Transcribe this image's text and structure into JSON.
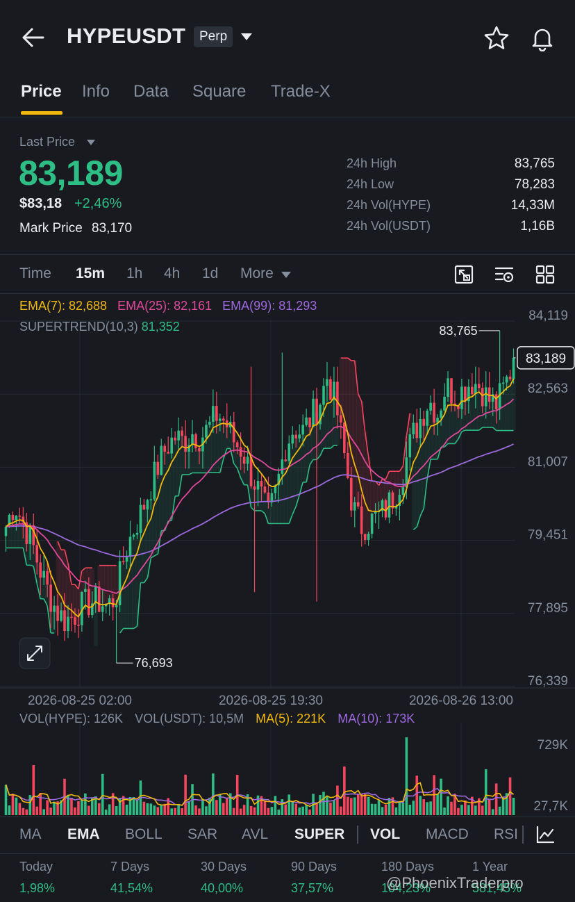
{
  "header": {
    "pair": "HYPEUSDT",
    "badge": "Perp"
  },
  "tabs": [
    {
      "label": "Price",
      "active": true
    },
    {
      "label": "Info"
    },
    {
      "label": "Data"
    },
    {
      "label": "Square"
    },
    {
      "label": "Trade-X"
    }
  ],
  "price": {
    "last_price_label": "Last Price",
    "last_price": "83,189",
    "usd_price": "$83,18",
    "change": "+2,46%",
    "mark_price_label": "Mark Price",
    "mark_price": "83,170"
  },
  "stats": [
    {
      "label": "24h High",
      "value": "83,765"
    },
    {
      "label": "24h Low",
      "value": "78,283"
    },
    {
      "label": "24h Vol(HYPE)",
      "value": "14,33M"
    },
    {
      "label": "24h Vol(USDT)",
      "value": "1,16B"
    }
  ],
  "intervals": {
    "time": "Time",
    "m15": "15m",
    "h1": "1h",
    "h4": "4h",
    "d1": "1d",
    "more": "More"
  },
  "legend": {
    "ema7": "EMA(7): 82,688",
    "ema25": "EMA(25): 82,161",
    "ema99": "EMA(99): 81,293",
    "supertrend_label": "SUPERTREND(10,3)",
    "supertrend_value": "81,352"
  },
  "volume_legend": {
    "vol_hype": "VOL(HYPE): 126K",
    "vol_usdt": "VOL(USDT): 10,5M",
    "ma5": "MA(5): 221K",
    "ma10": "MA(10): 173K"
  },
  "chart_data": {
    "type": "candlestick",
    "y_ticks": [
      "84,119",
      "82,563",
      "81,007",
      "79,451",
      "77,895",
      "76,339"
    ],
    "ylim": [
      76339,
      84119
    ],
    "x_ticks": [
      "2026-08-25 02:00",
      "2026-08-25 19:30",
      "2026-08-26 13:00"
    ],
    "current_price_label": "83,189",
    "current_price": 83189,
    "high_annotation": "83,765",
    "high_value": 83765,
    "low_annotation": "76,693",
    "low_value": 76693,
    "close_path": [
      79600,
      80100,
      79700,
      79300,
      78700,
      78200,
      77800,
      77600,
      77700,
      77900,
      78000,
      78000,
      77900,
      78100,
      79000,
      79500,
      79900,
      80400,
      80900,
      81300,
      81500,
      81400,
      81600,
      81500,
      81700,
      82000,
      81800,
      81400,
      81200,
      80700,
      80300,
      79800,
      80400,
      81300,
      81700,
      81600,
      81900,
      82200,
      82800,
      82200,
      81100,
      80000,
      79600,
      79700,
      79800,
      80000,
      80300,
      80800,
      81500,
      81900,
      82300,
      82000,
      82600,
      82400,
      82500,
      82700,
      82600,
      82300,
      82200,
      82600,
      83100
    ],
    "volume_ticks": [
      "729K",
      "27,7K"
    ],
    "series": [
      {
        "name": "EMA(7)",
        "color": "#f0b90b"
      },
      {
        "name": "EMA(25)",
        "color": "#e0499b"
      },
      {
        "name": "EMA(99)",
        "color": "#9c6ade"
      }
    ],
    "supertrend_color": "#2ebd85",
    "supertrend_down_color": "#f6465d"
  },
  "indicator_tabs": [
    {
      "label": "MA"
    },
    {
      "label": "EMA",
      "active": true
    },
    {
      "label": "BOLL"
    },
    {
      "label": "SAR"
    },
    {
      "label": "AVL"
    },
    {
      "label": "SUPER",
      "active": true
    },
    {
      "label": "VOL",
      "active": true
    },
    {
      "label": "MACD"
    },
    {
      "label": "RSI"
    }
  ],
  "performance": [
    {
      "label": "Today",
      "value": "1,98%"
    },
    {
      "label": "7 Days",
      "value": "41,54%"
    },
    {
      "label": "30 Days",
      "value": "40,00%"
    },
    {
      "label": "90 Days",
      "value": "37,57%"
    },
    {
      "label": "180 Days",
      "value": "104,23%"
    },
    {
      "label": "1 Year",
      "value": "581,45%"
    }
  ],
  "watermark": "@PhoenixTraderpro",
  "colors": {
    "up": "#2ebd85",
    "down": "#f6465d",
    "accent": "#f0b90b",
    "background": "#181a20"
  }
}
